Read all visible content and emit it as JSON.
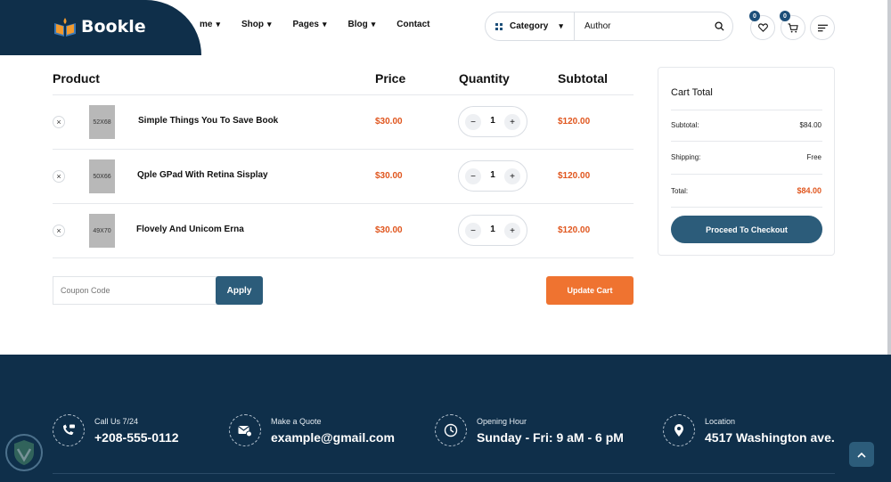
{
  "brand": {
    "name": "Bookle"
  },
  "nav": [
    {
      "label": "me",
      "chev": "⌄"
    },
    {
      "label": "Shop"
    },
    {
      "label": "Pages"
    },
    {
      "label": "Blog"
    },
    {
      "label": "Contact"
    }
  ],
  "search": {
    "category_label": "Category",
    "author_value": "Author"
  },
  "badges": {
    "wishlist": "0",
    "cart": "0"
  },
  "table": {
    "headers": {
      "product": "Product",
      "price": "Price",
      "quantity": "Quantity",
      "subtotal": "Subtotal"
    },
    "rows": [
      {
        "thumb": "52X68",
        "name": "Simple Things You To Save Book",
        "price": "$30.00",
        "qty": "1",
        "subtotal": "$120.00"
      },
      {
        "thumb": "50X66",
        "name": "Qple GPad With Retina Sisplay",
        "price": "$30.00",
        "qty": "1",
        "subtotal": "$120.00"
      },
      {
        "thumb": "49X70",
        "name": "Flovely And Unicom Erna",
        "price": "$30.00",
        "qty": "1",
        "subtotal": "$120.00"
      }
    ],
    "minus": "−",
    "plus": "+",
    "remove": "×"
  },
  "coupon": {
    "placeholder": "Coupon Code",
    "apply_label": "Apply",
    "update_label": "Update Cart"
  },
  "cart_total": {
    "title": "Cart Total",
    "subtotal_label": "Subtotal:",
    "subtotal_value": "$84.00",
    "shipping_label": "Shipping:",
    "shipping_value": "Free",
    "total_label": "Total:",
    "total_value": "$84.00",
    "checkout_label": "Proceed To Checkout"
  },
  "footer": [
    {
      "icon": "phone-icon",
      "label": "Call Us 7/24",
      "value": "+208-555-0112"
    },
    {
      "icon": "mail-icon",
      "label": "Make a Quote",
      "value": "example@gmail.com"
    },
    {
      "icon": "clock-icon",
      "label": "Opening Hour",
      "value": "Sunday - Fri: 9 aM - 6 pM"
    },
    {
      "icon": "location-pin-icon",
      "label": "Location",
      "value": "4517 Washington ave."
    }
  ],
  "colors": {
    "navy": "#0f2f4a",
    "teal": "#2c5c7a",
    "orange": "#ef7330",
    "accent_text": "#e0561e"
  }
}
